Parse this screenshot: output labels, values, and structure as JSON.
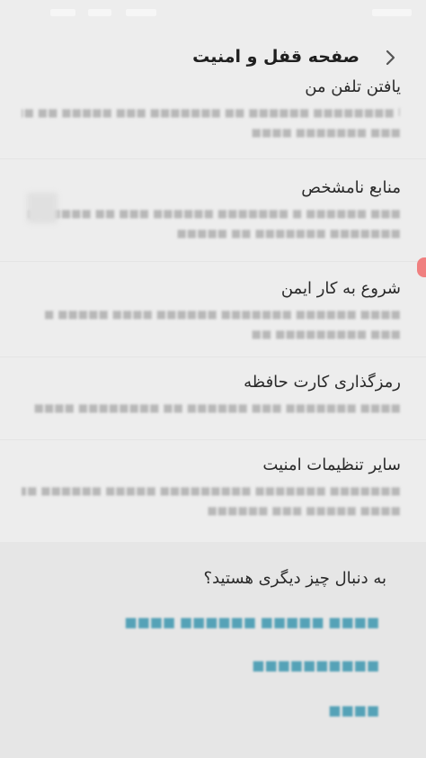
{
  "header": {
    "title": "صفحه قفل و امنیت"
  },
  "sections": [
    {
      "title": "یافتن تلفن من",
      "desc1": "ا ■■■■■■■■ ■■■■■■ ■■ ■■■■■■■ ■■■ ■■■■■ ■■ ■■■■■",
      "desc2": "■■■ ■■■■■■■ ■■■■"
    },
    {
      "title": "منابع نامشخص",
      "desc1": "■■■ ■■■■■■ ■ ■■■■■■■ ■■■■■■ ■■■ ■■ ■■■■■ ■",
      "desc2": "■■■■■■■ ■■■■■■■ ■■ ■■■■■"
    },
    {
      "title": "شروع به کار ایمن",
      "desc1": "■■■■ ■■■■■■ ■■■■■■■ ■■■■■■ ■■■■ ■■■■■ ■",
      "desc2": "■■■ ■■■■■■■■■ ■■"
    },
    {
      "title": "رمزگذاری کارت حافظه",
      "desc1": "■■■■ ■■■■■■■ ■■■ ■■■■■■ ■■ ■■■■■■■■ ■■■■",
      "desc2": ""
    },
    {
      "title": "سایر تنظیمات امنیت",
      "desc1": "■■■■■■■ ■■■■■■■ ■■■■■■■■■ ■■■■■ ■■■■■■ ■■■■",
      "desc2": "■■■■ ■■■■■ ■■■ ■■■■■■"
    }
  ],
  "card": {
    "title": "به دنبال چیز دیگری هستید؟",
    "links": [
      "■■■■ ■■■■■ ■■■■■■ ■■■■",
      "■■■■■■■■■■",
      "■■■■"
    ]
  },
  "colors": {
    "background": "#ededed",
    "link": "#55a2b7",
    "accent_tab": "#f08080"
  },
  "icons": {
    "back": "chevron-right-icon"
  }
}
